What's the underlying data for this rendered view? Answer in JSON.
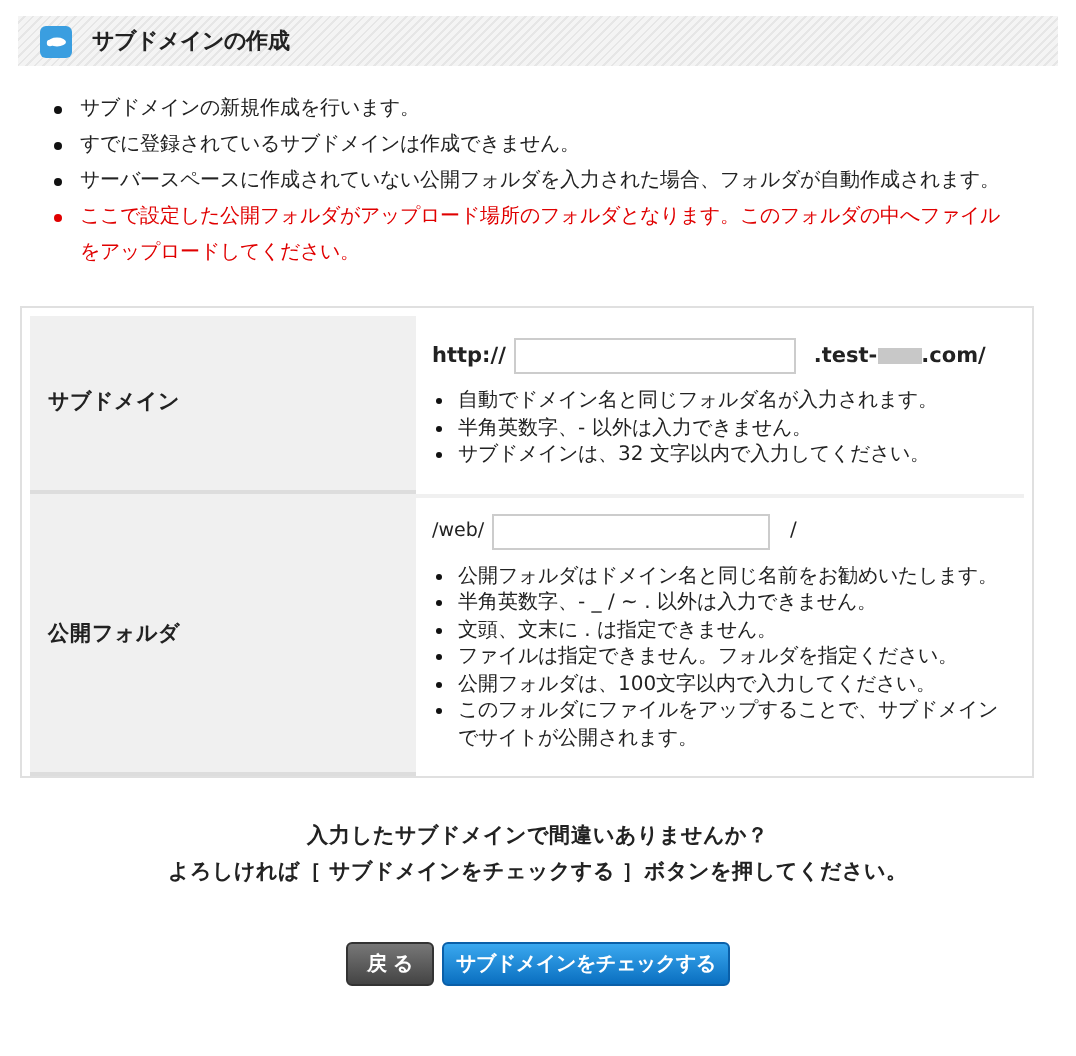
{
  "header": {
    "title": "サブドメインの作成"
  },
  "notes": [
    {
      "text": "サブドメインの新規作成を行います。",
      "kind": "normal"
    },
    {
      "text": "すでに登録されているサブドメインは作成できません。",
      "kind": "normal"
    },
    {
      "text": "サーバースペースに作成されていない公開フォルダを入力された場合、フォルダが自動作成されます。",
      "kind": "normal"
    },
    {
      "text": "ここで設定した公開フォルダがアップロード場所のフォルダとなります。このフォルダの中へファイルをアップロードしてください。",
      "kind": "warning"
    }
  ],
  "form": {
    "rows": [
      {
        "label": "サブドメイン",
        "prefix": "http://",
        "kind": "domain",
        "domain_start": ".test-",
        "domain_end": ".com/",
        "hints": [
          "自動でドメイン名と同じフォルダ名が入力されます。",
          "半角英数字、- 以外は入力できません。",
          "サブドメインは、32 文字以内で入力してください。"
        ]
      },
      {
        "label": "公開フォルダ",
        "prefix": "/web/",
        "kind": "folder",
        "suffix": "/",
        "hints": [
          "公開フォルダはドメイン名と同じ名前をお勧めいたします。",
          "半角英数字、- _ / ~ . 以外は入力できません。",
          "文頭、文末に . は指定できません。",
          "ファイルは指定できません。フォルダを指定ください。",
          "公開フォルダは、100文字以内で入力してください。",
          "このフォルダにファイルをアップすることで、サブドメインでサイトが公開されます。"
        ]
      }
    ]
  },
  "confirm": [
    "入力したサブドメインで間違いありませんか？",
    "よろしければ［ サブドメインをチェックする ］ボタンを押してください。"
  ],
  "buttons": {
    "back": "戻 る",
    "submit": "サブドメインをチェックする"
  }
}
